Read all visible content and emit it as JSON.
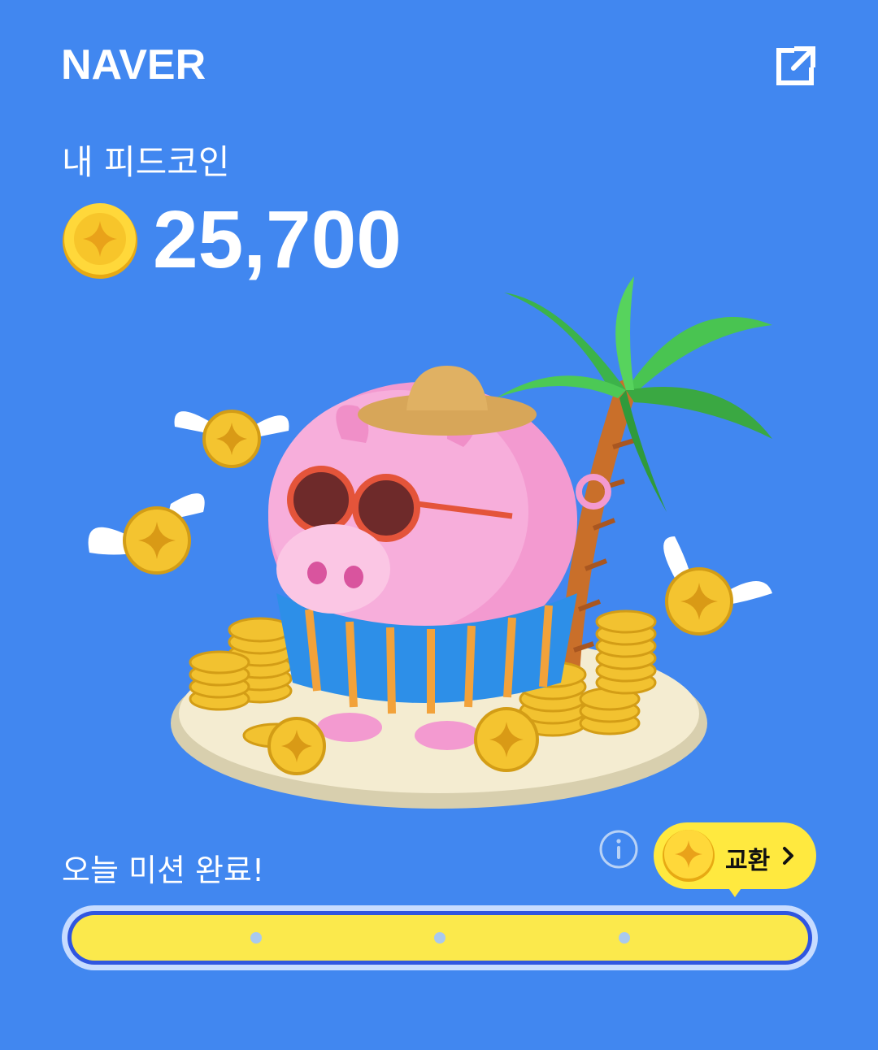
{
  "header": {
    "brand": "NAVER",
    "share_icon": "external-link-icon"
  },
  "wallet": {
    "title": "내 피드코인",
    "coin_icon": "coin-icon",
    "balance": "25,700"
  },
  "illustration": {
    "name": "piggy-bank-beach-illustration"
  },
  "mission": {
    "label": "오늘 미션 완료!",
    "info_icon": "info-icon",
    "exchange_label": "교환",
    "exchange_icon": "coin-icon",
    "progress": 1.0,
    "checkpoints": 3
  },
  "colors": {
    "background": "#4187f0",
    "accent_yellow": "#ffe93f",
    "progress_border": "#2f56e0",
    "coin_gold": "#f4c430"
  }
}
